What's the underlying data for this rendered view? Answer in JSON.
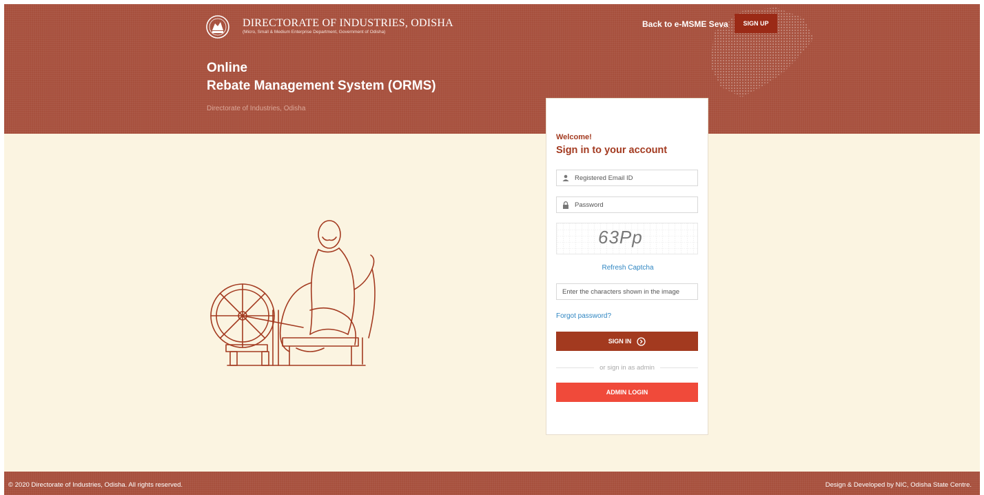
{
  "header": {
    "org_title": "DIRECTORATE OF INDUSTRIES, ODISHA",
    "org_subtitle": "(Micro, Small & Medium Enterprise Department, Government of Odisha)",
    "back_link": "Back to e-MSME Seva",
    "signup_label": "SIGN UP",
    "heading_line1": "Online",
    "heading_line2": "Rebate Management System (ORMS)",
    "sub_heading": "Directorate of Industries, Odisha"
  },
  "login": {
    "welcome": "Welcome!",
    "title": "Sign in to your account",
    "email_placeholder": "Registered Email ID",
    "password_placeholder": "Password",
    "captcha_text": "63Pp",
    "refresh_label": "Refresh Captcha",
    "captcha_placeholder": "Enter the characters shown in the image",
    "forgot_label": "Forgot password?",
    "signin_label": "SIGN IN",
    "or_text": "or sign in as admin",
    "admin_label": "ADMIN LOGIN"
  },
  "footer": {
    "copyright": "© 2020 Directorate of Industries, Odisha. All rights reserved.",
    "credit": "Design & Developed by NIC, Odisha State Centre."
  },
  "colors": {
    "brand": "#a7503d",
    "accent": "#a33a20",
    "admin": "#f04a3a",
    "link": "#2f86c2",
    "background": "#fbf4e1"
  },
  "icons": {
    "emblem": "odisha-emblem-icon",
    "user": "user-icon",
    "lock": "lock-icon",
    "arrow": "arrow-circle-right-icon",
    "illustration": "charkha-illustration"
  }
}
